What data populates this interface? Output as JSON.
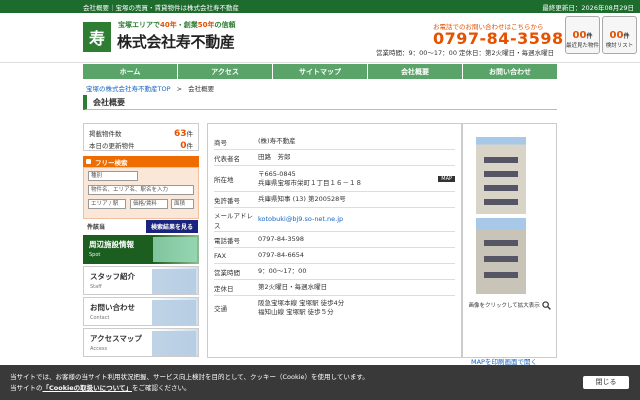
{
  "topbar": {
    "left": "会社概要｜宝塚の売買・賃貸物件は株式会社寿不動産",
    "date_label": "最終更新日：2026年08月29日"
  },
  "header": {
    "logo_char": "寿",
    "catch_pre": "宝塚エリアで",
    "catch_hl1": "40年",
    "catch_mid": "・創業",
    "catch_hl2": "50年",
    "catch_end": "の信頼",
    "company": "株式会社寿不動産",
    "tel_caption": "お電話でのお問い合わせはこちらから",
    "tel": "0797-84-3598",
    "hours": "営業時間：9：00〜17：00 定休日：第2火曜日・毎週水曜日",
    "viewed": {
      "num": "00",
      "unit": "件",
      "label": "最近見た物件"
    },
    "shortlist": {
      "num": "00",
      "unit": "件",
      "label": "検討リスト"
    }
  },
  "nav": [
    "ホーム",
    "アクセス",
    "サイトマップ",
    "会社概要",
    "お問い合わせ"
  ],
  "breadcrumb": {
    "home": "宝塚の株式会社寿不動産TOP",
    "sep": ">",
    "current": "会社概要"
  },
  "page_title": "会社概要",
  "sidebar": {
    "listing_label": "掲載物件数",
    "listing_count": "63",
    "listing_unit": "件",
    "updated_label": "本日の更新物件",
    "updated_count": "0",
    "updated_unit": "件",
    "free_search": "フリー検索",
    "type_placeholder": "種別",
    "keyword_placeholder": "物件名、エリア名、駅名を入力",
    "area_placeholder": "エリア / 駅",
    "price_placeholder": "価格/賃料",
    "size_placeholder": "面積",
    "count_label": "件該当",
    "search_button": "検索結果を見る",
    "banners": [
      {
        "title": "周辺施設情報",
        "sub": "Spot"
      },
      {
        "title": "スタッフ紹介",
        "sub": "Staff"
      },
      {
        "title": "お問い合わせ",
        "sub": "Contact"
      },
      {
        "title": "アクセスマップ",
        "sub": "Access"
      }
    ]
  },
  "info": [
    {
      "key": "商号",
      "value": "(株)寿不動産"
    },
    {
      "key": "代表者名",
      "value": "田路　芳郎"
    },
    {
      "key": "所在地",
      "value": "〒665-0845",
      "value2": "兵庫県宝塚市栄町１丁目１６－１８",
      "badge": "MAP"
    },
    {
      "key": "免許番号",
      "value": "兵庫県知事 (13) 第200528号"
    },
    {
      "key": "メールアドレス",
      "value": "kotobuki@bj9.so-net.ne.jp",
      "link": true
    },
    {
      "key": "電話番号",
      "value": "0797-84-3598"
    },
    {
      "key": "FAX",
      "value": "0797-84-6654"
    },
    {
      "key": "営業時間",
      "value": "9：00〜17：00"
    },
    {
      "key": "定休日",
      "value": "第2火曜日・毎週水曜日"
    },
    {
      "key": "交通",
      "value": "阪急宝塚本線 宝塚駅 徒歩4分",
      "value2": "福知山線 宝塚駅 徒歩５分"
    }
  ],
  "photos": {
    "zoom_text": "画像をクリックして拡大表示"
  },
  "map_link": "MAPを印刷画面で開く",
  "cookie": {
    "line1": "当サイトでは、お客様の当サイト利用状況把握、サービス向上検討を目的として、クッキー（Cookie）を使用しています。",
    "line2_pre": "当サイトの",
    "line2_link": "「Cookieの取扱いについて」",
    "line2_post": "をご確認ください。",
    "close": "閉じる"
  }
}
